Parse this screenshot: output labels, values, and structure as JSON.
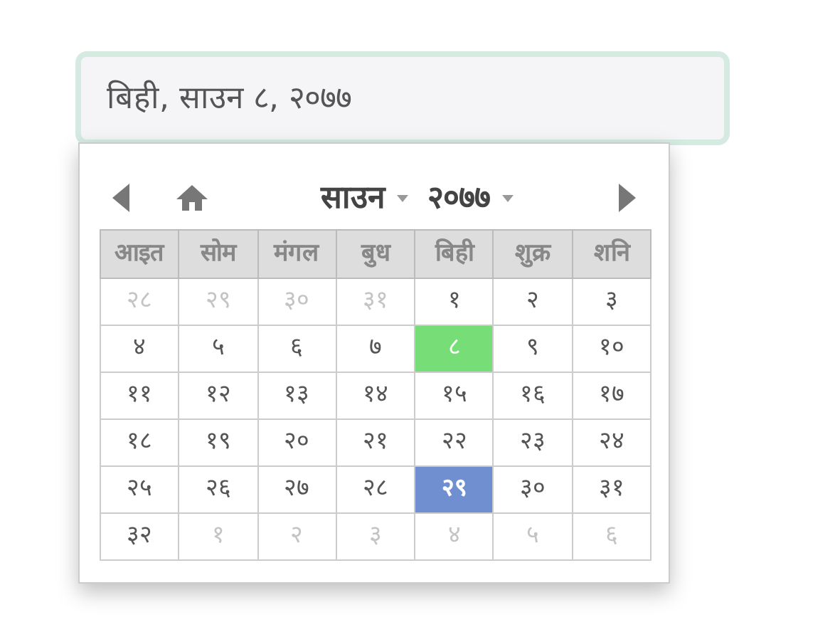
{
  "date_field": {
    "value": "बिही, साउन ८, २०७७"
  },
  "calendar": {
    "month": "साउन",
    "year": "२०७७",
    "weekdays": [
      "आइत",
      "सोम",
      "मंगल",
      "बुध",
      "बिही",
      "शुक्र",
      "शनि"
    ],
    "weeks": [
      [
        {
          "label": "२८",
          "muted": true,
          "selected": false,
          "today": false
        },
        {
          "label": "२९",
          "muted": true,
          "selected": false,
          "today": false
        },
        {
          "label": "३०",
          "muted": true,
          "selected": false,
          "today": false
        },
        {
          "label": "३१",
          "muted": true,
          "selected": false,
          "today": false
        },
        {
          "label": "१",
          "muted": false,
          "selected": false,
          "today": false
        },
        {
          "label": "२",
          "muted": false,
          "selected": false,
          "today": false
        },
        {
          "label": "३",
          "muted": false,
          "selected": false,
          "today": false
        }
      ],
      [
        {
          "label": "४",
          "muted": false,
          "selected": false,
          "today": false
        },
        {
          "label": "५",
          "muted": false,
          "selected": false,
          "today": false
        },
        {
          "label": "६",
          "muted": false,
          "selected": false,
          "today": false
        },
        {
          "label": "७",
          "muted": false,
          "selected": false,
          "today": false
        },
        {
          "label": "८",
          "muted": false,
          "selected": true,
          "today": false
        },
        {
          "label": "९",
          "muted": false,
          "selected": false,
          "today": false
        },
        {
          "label": "१०",
          "muted": false,
          "selected": false,
          "today": false
        }
      ],
      [
        {
          "label": "११",
          "muted": false,
          "selected": false,
          "today": false
        },
        {
          "label": "१२",
          "muted": false,
          "selected": false,
          "today": false
        },
        {
          "label": "१३",
          "muted": false,
          "selected": false,
          "today": false
        },
        {
          "label": "१४",
          "muted": false,
          "selected": false,
          "today": false
        },
        {
          "label": "१५",
          "muted": false,
          "selected": false,
          "today": false
        },
        {
          "label": "१६",
          "muted": false,
          "selected": false,
          "today": false
        },
        {
          "label": "१७",
          "muted": false,
          "selected": false,
          "today": false
        }
      ],
      [
        {
          "label": "१८",
          "muted": false,
          "selected": false,
          "today": false
        },
        {
          "label": "१९",
          "muted": false,
          "selected": false,
          "today": false
        },
        {
          "label": "२०",
          "muted": false,
          "selected": false,
          "today": false
        },
        {
          "label": "२१",
          "muted": false,
          "selected": false,
          "today": false
        },
        {
          "label": "२२",
          "muted": false,
          "selected": false,
          "today": false
        },
        {
          "label": "२३",
          "muted": false,
          "selected": false,
          "today": false
        },
        {
          "label": "२४",
          "muted": false,
          "selected": false,
          "today": false
        }
      ],
      [
        {
          "label": "२५",
          "muted": false,
          "selected": false,
          "today": false
        },
        {
          "label": "२६",
          "muted": false,
          "selected": false,
          "today": false
        },
        {
          "label": "२७",
          "muted": false,
          "selected": false,
          "today": false
        },
        {
          "label": "२८",
          "muted": false,
          "selected": false,
          "today": false
        },
        {
          "label": "२९",
          "muted": false,
          "selected": false,
          "today": true
        },
        {
          "label": "३०",
          "muted": false,
          "selected": false,
          "today": false
        },
        {
          "label": "३१",
          "muted": false,
          "selected": false,
          "today": false
        }
      ],
      [
        {
          "label": "३२",
          "muted": false,
          "selected": false,
          "today": false
        },
        {
          "label": "१",
          "muted": true,
          "selected": false,
          "today": false
        },
        {
          "label": "२",
          "muted": true,
          "selected": false,
          "today": false
        },
        {
          "label": "३",
          "muted": true,
          "selected": false,
          "today": false
        },
        {
          "label": "४",
          "muted": true,
          "selected": false,
          "today": false
        },
        {
          "label": "५",
          "muted": true,
          "selected": false,
          "today": false
        },
        {
          "label": "६",
          "muted": true,
          "selected": false,
          "today": false
        }
      ]
    ]
  }
}
